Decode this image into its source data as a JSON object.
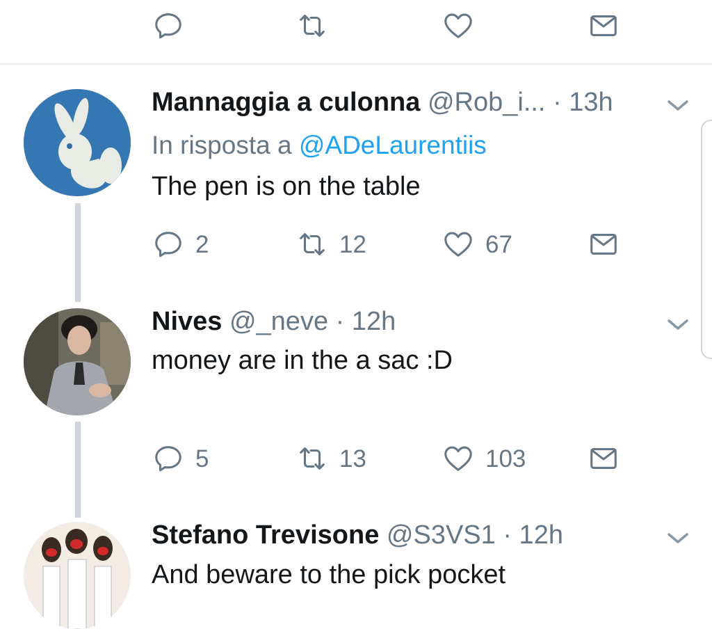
{
  "top_actions": {
    "reply_count": "",
    "retweet_count": "",
    "like_count": ""
  },
  "tweets": [
    {
      "name": "Mannaggia a culonna",
      "handle": "@Rob_i...",
      "time": "· 13h",
      "reply_prefix": "In risposta a",
      "reply_mention": "@ADeLaurentiis",
      "text": "The pen is on the table",
      "reply_count": "2",
      "retweet_count": "12",
      "like_count": "67"
    },
    {
      "name": "Nives",
      "handle": "@_neve",
      "time": "· 12h",
      "text": "money are in the a sac :D",
      "reply_count": "5",
      "retweet_count": "13",
      "like_count": "103"
    },
    {
      "name": "Stefano Trevisone",
      "handle": "@S3VS1",
      "time": "· 12h",
      "text": "And beware to the pick pocket"
    }
  ],
  "icons": {
    "reply": "reply-icon",
    "retweet": "retweet-icon",
    "like": "heart-icon",
    "message": "envelope-icon",
    "more": "chevron-down-icon"
  },
  "colors": {
    "text": "#14171a",
    "secondary": "#657786",
    "link": "#1da1f2",
    "thread_line": "#ccd6dd",
    "divider": "#e6ecf0"
  }
}
